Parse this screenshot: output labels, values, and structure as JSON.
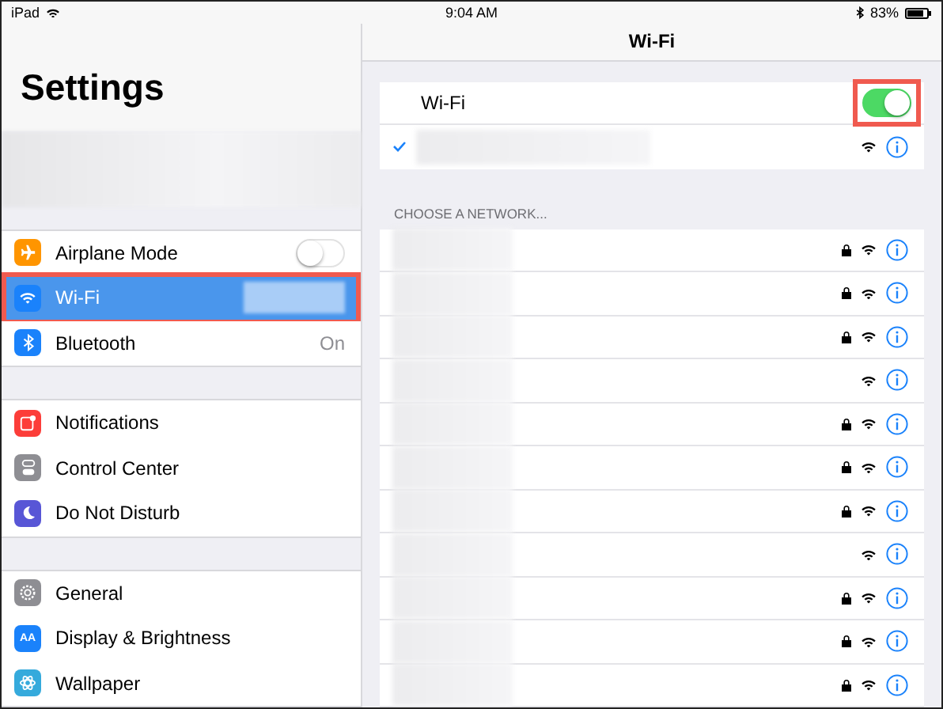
{
  "status_bar": {
    "device": "iPad",
    "time": "9:04 AM",
    "battery": "83%"
  },
  "sidebar": {
    "title": "Settings",
    "groups": [
      [
        {
          "label": "Airplane Mode",
          "kind": "toggle",
          "on": false,
          "selected": false
        },
        {
          "label": "Wi-Fi",
          "kind": "redacted",
          "selected": true,
          "highlighted": true
        },
        {
          "label": "Bluetooth",
          "kind": "value",
          "value": "On",
          "selected": false
        }
      ],
      [
        {
          "label": "Notifications",
          "kind": "plain",
          "selected": false
        },
        {
          "label": "Control Center",
          "kind": "plain",
          "selected": false
        },
        {
          "label": "Do Not Disturb",
          "kind": "plain",
          "selected": false
        }
      ],
      [
        {
          "label": "General",
          "kind": "plain",
          "selected": false
        },
        {
          "label": "Display & Brightness",
          "icon_text": "AA",
          "kind": "plain",
          "selected": false
        },
        {
          "label": "Wallpaper",
          "kind": "plain",
          "selected": false
        }
      ]
    ]
  },
  "detail": {
    "title": "Wi-Fi",
    "wifi_row": {
      "label": "Wi-Fi",
      "on": true,
      "highlighted": true
    },
    "connected": {
      "checked": true
    },
    "section_heading": "CHOOSE A NETWORK...",
    "networks": [
      {
        "locked": true
      },
      {
        "locked": true
      },
      {
        "locked": true
      },
      {
        "locked": false
      },
      {
        "locked": true
      },
      {
        "locked": true
      },
      {
        "locked": true
      },
      {
        "locked": false
      },
      {
        "locked": true
      },
      {
        "locked": true
      },
      {
        "locked": true
      }
    ]
  }
}
